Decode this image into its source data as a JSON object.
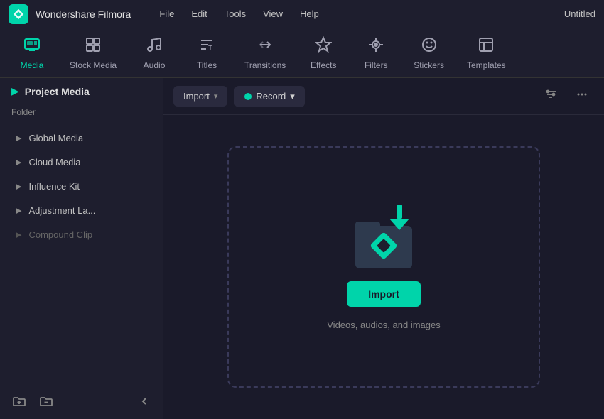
{
  "titleBar": {
    "appName": "Wondershare Filmora",
    "menuItems": [
      "File",
      "Edit",
      "Tools",
      "View",
      "Help"
    ],
    "windowTitle": "Untitled"
  },
  "tabBar": {
    "tabs": [
      {
        "id": "media",
        "label": "Media",
        "icon": "media"
      },
      {
        "id": "stock-media",
        "label": "Stock Media",
        "icon": "stock"
      },
      {
        "id": "audio",
        "label": "Audio",
        "icon": "audio"
      },
      {
        "id": "titles",
        "label": "Titles",
        "icon": "titles"
      },
      {
        "id": "transitions",
        "label": "Transitions",
        "icon": "transitions"
      },
      {
        "id": "effects",
        "label": "Effects",
        "icon": "effects"
      },
      {
        "id": "filters",
        "label": "Filters",
        "icon": "filters"
      },
      {
        "id": "stickers",
        "label": "Stickers",
        "icon": "stickers"
      },
      {
        "id": "templates",
        "label": "Templates",
        "icon": "templates"
      }
    ],
    "activeTab": "media"
  },
  "sidebar": {
    "headerTitle": "Project Media",
    "sectionLabel": "Folder",
    "items": [
      {
        "id": "global-media",
        "label": "Global Media",
        "dimmed": false
      },
      {
        "id": "cloud-media",
        "label": "Cloud Media",
        "dimmed": false
      },
      {
        "id": "influence-kit",
        "label": "Influence Kit",
        "dimmed": false
      },
      {
        "id": "adjustment-la",
        "label": "Adjustment La...",
        "dimmed": false
      },
      {
        "id": "compound-clip",
        "label": "Compound Clip",
        "dimmed": true
      }
    ],
    "footerButtons": {
      "addFolder": "＋",
      "addFolderAlt": "📁",
      "collapse": "‹"
    }
  },
  "toolbar": {
    "importLabel": "Import",
    "recordLabel": "Record",
    "importDropdownArrow": "▾",
    "recordDropdownArrow": "▾",
    "filterIcon": "filter",
    "moreIcon": "more"
  },
  "importZone": {
    "buttonLabel": "Import",
    "hintText": "Videos, audios, and images"
  }
}
